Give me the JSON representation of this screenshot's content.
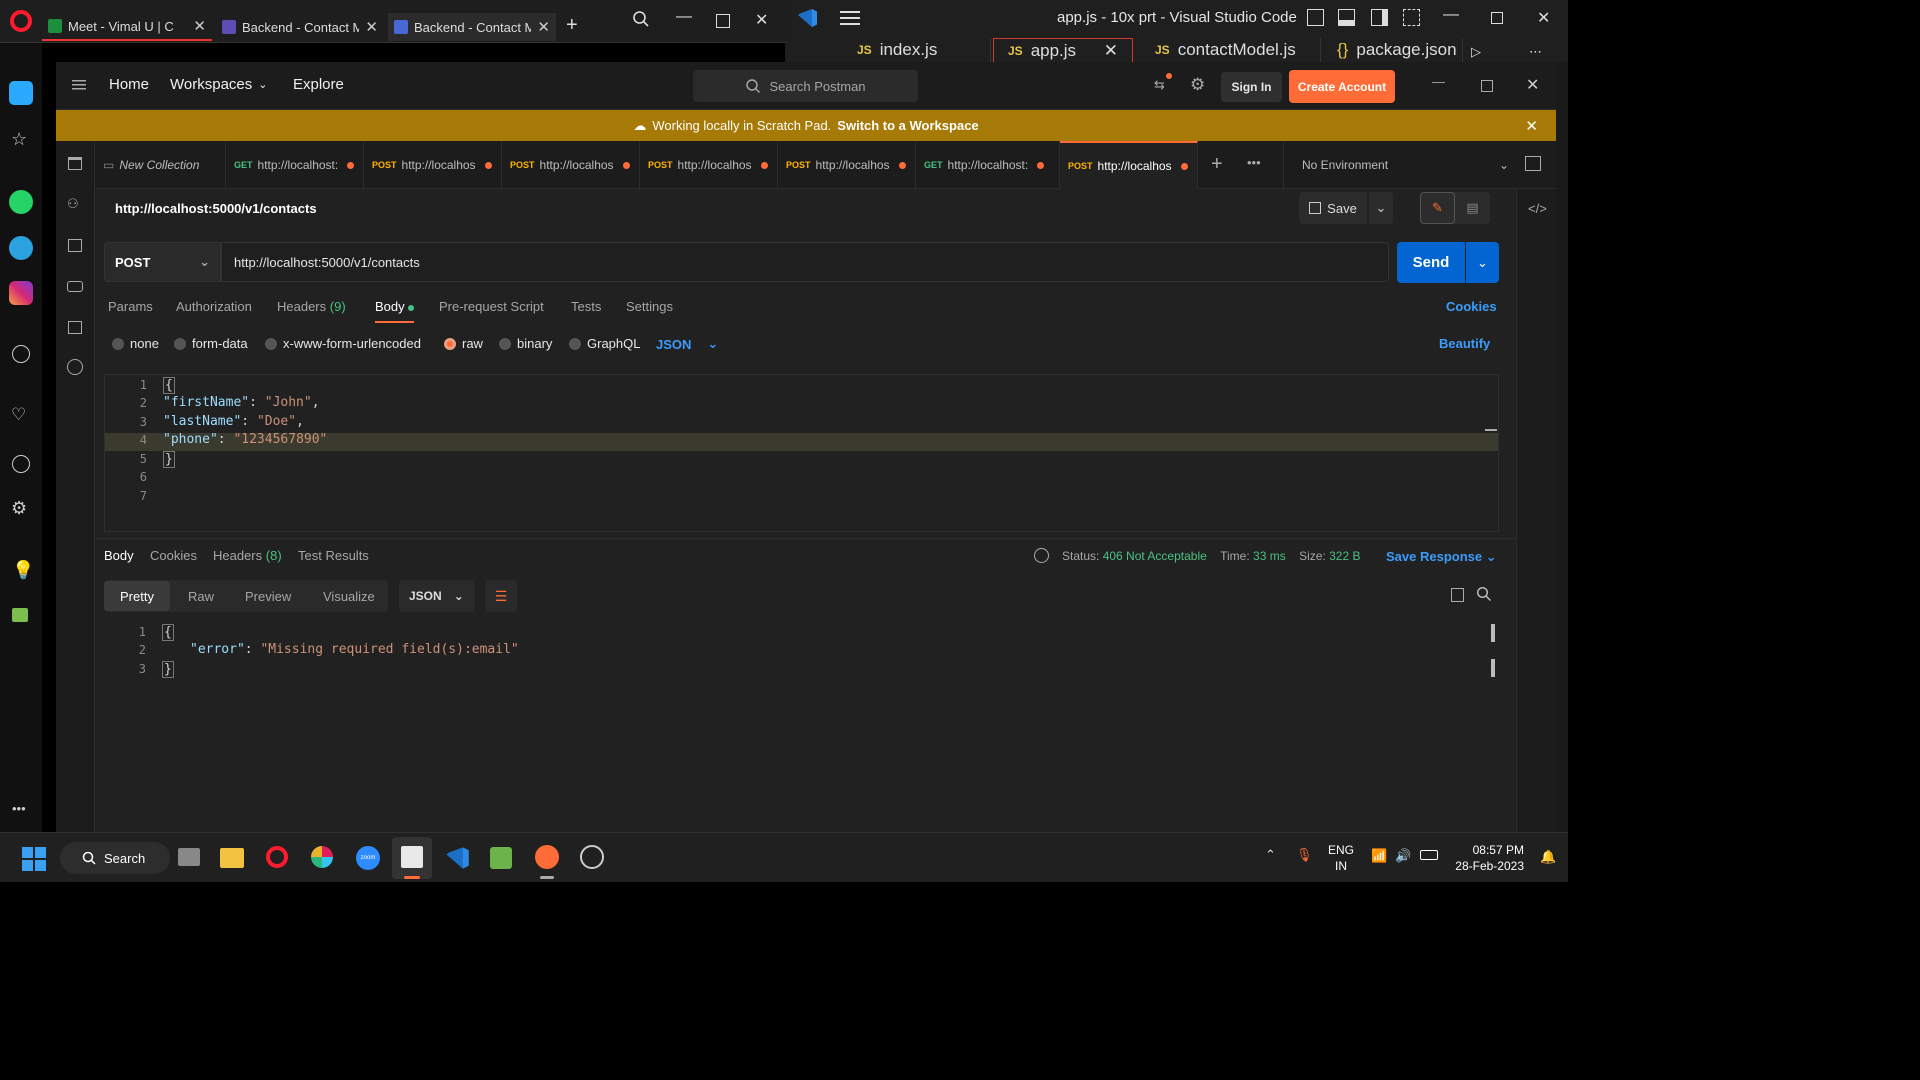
{
  "opera": {
    "tabs": [
      {
        "label": "Meet - Vimal U | C",
        "color": "#1e8e3e"
      },
      {
        "label": "Backend - Contact Ma",
        "color": "#5e4db2"
      },
      {
        "label": "Backend - Contact Ma",
        "color": "#4a67d6"
      }
    ]
  },
  "vscode": {
    "title": "app.js - 10x prt - Visual Studio Code",
    "tabs": [
      "index.js",
      "app.js",
      "contactModel.js",
      "package.json"
    ]
  },
  "postman": {
    "nav": {
      "home": "Home",
      "workspaces": "Workspaces",
      "explore": "Explore"
    },
    "search_placeholder": "Search Postman",
    "sign_in": "Sign In",
    "create_account": "Create Account",
    "banner": {
      "text": "Working locally in Scratch Pad.",
      "link": "Switch to a Workspace"
    },
    "collection_tab": "New Collection",
    "request_tabs": [
      {
        "method": "GET",
        "url": "http://localhost:"
      },
      {
        "method": "POST",
        "url": "http://localhos"
      },
      {
        "method": "POST",
        "url": "http://localhos"
      },
      {
        "method": "POST",
        "url": "http://localhos"
      },
      {
        "method": "POST",
        "url": "http://localhos"
      },
      {
        "method": "GET",
        "url": "http://localhost:"
      },
      {
        "method": "POST",
        "url": "http://localhos"
      }
    ],
    "environment": "No Environment",
    "request_title": "http://localhost:5000/v1/contacts",
    "save_label": "Save",
    "method": "POST",
    "url": "http://localhost:5000/v1/contacts",
    "send_label": "Send",
    "request_tabs_sub": {
      "params": "Params",
      "authorization": "Authorization",
      "headers": "Headers",
      "headers_count": "(9)",
      "body": "Body",
      "pre_request": "Pre-request Script",
      "tests": "Tests",
      "settings": "Settings",
      "cookies": "Cookies"
    },
    "body_types": {
      "none": "none",
      "form_data": "form-data",
      "urlencoded": "x-www-form-urlencoded",
      "raw": "raw",
      "binary": "binary",
      "graphql": "GraphQL",
      "format": "JSON",
      "beautify": "Beautify"
    },
    "request_body_lines": [
      {
        "n": "1",
        "text": "{"
      },
      {
        "n": "2",
        "key": "\"firstName\"",
        "value": "\"John\"",
        "tail": ","
      },
      {
        "n": "3",
        "key": "\"lastName\"",
        "value": "\"Doe\"",
        "tail": ","
      },
      {
        "n": "4",
        "key": "\"phone\"",
        "value": "\"1234567890\"",
        "tail": ""
      },
      {
        "n": "5",
        "text": "}"
      },
      {
        "n": "6",
        "text": ""
      },
      {
        "n": "7",
        "text": ""
      }
    ],
    "response": {
      "tabs": {
        "body": "Body",
        "cookies": "Cookies",
        "headers": "Headers",
        "headers_count": "(8)",
        "tests": "Test Results"
      },
      "status_label": "Status:",
      "status": "406 Not Acceptable",
      "time_label": "Time:",
      "time": "33 ms",
      "size_label": "Size:",
      "size": "322 B",
      "save_response": "Save Response",
      "views": {
        "pretty": "Pretty",
        "raw": "Raw",
        "preview": "Preview",
        "visualize": "Visualize",
        "format": "JSON"
      },
      "lines": [
        {
          "n": "1",
          "text": "{"
        },
        {
          "n": "2",
          "key": "\"error\"",
          "value": "\"Missing required field(s):email\""
        },
        {
          "n": "3",
          "text": "}"
        }
      ]
    }
  },
  "taskbar": {
    "search": "Search",
    "lang1": "ENG",
    "lang2": "IN",
    "time": "08:57 PM",
    "date": "28-Feb-2023"
  },
  "colors": {
    "accent": "#ff6c37",
    "send": "#0265d2",
    "banner": "#a77a07",
    "success": "#49c184",
    "link": "#3b9dfb"
  }
}
